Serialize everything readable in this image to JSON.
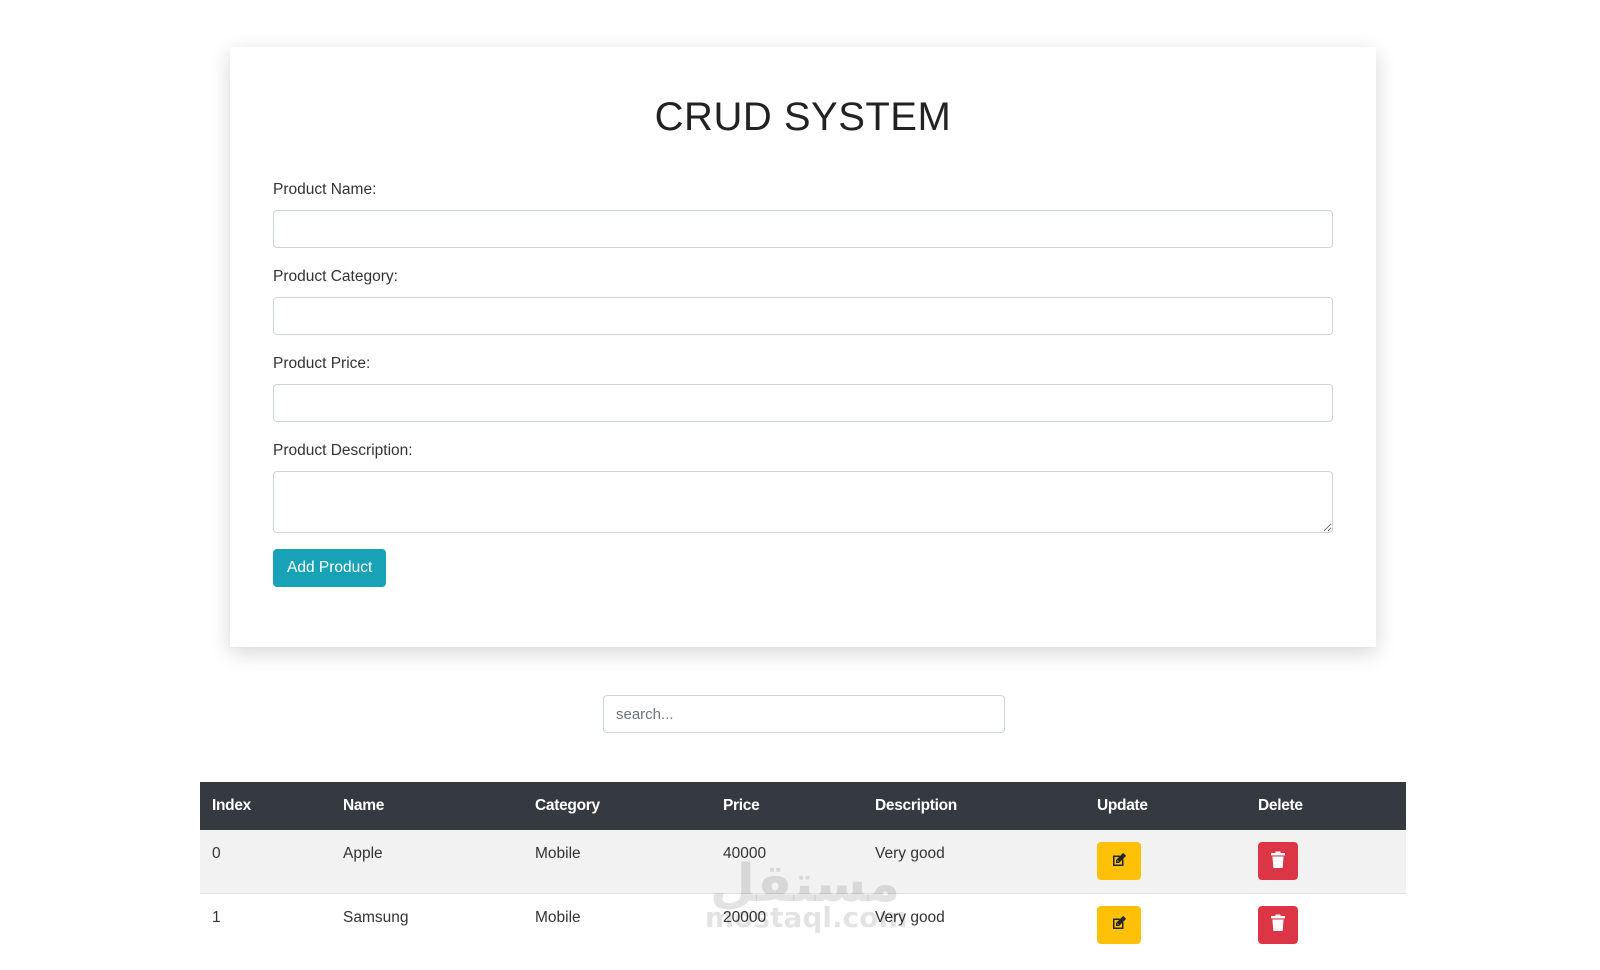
{
  "form": {
    "title": "CRUD SYSTEM",
    "fields": [
      {
        "label": "Product Name:",
        "value": ""
      },
      {
        "label": "Product Category:",
        "value": ""
      },
      {
        "label": "Product Price:",
        "value": ""
      },
      {
        "label": "Product Description:",
        "value": ""
      }
    ],
    "submit_label": "Add Product"
  },
  "search": {
    "placeholder": "search..."
  },
  "table": {
    "headers": [
      "Index",
      "Name",
      "Category",
      "Price",
      "Description",
      "Update",
      "Delete"
    ],
    "rows": [
      {
        "index": "0",
        "name": "Apple",
        "category": "Mobile",
        "price": "40000",
        "description": "Very good"
      },
      {
        "index": "1",
        "name": "Samsung",
        "category": "Mobile",
        "price": "20000",
        "description": "Very good"
      }
    ]
  },
  "watermark": {
    "arabic": "مستقل",
    "latin": "mostaql.com"
  },
  "colors": {
    "accent": "#17a2b8",
    "table_header": "#343a40",
    "update": "#ffc107",
    "delete": "#dc3545"
  },
  "icons": {
    "update": "edit-icon",
    "delete": "trash-icon"
  }
}
